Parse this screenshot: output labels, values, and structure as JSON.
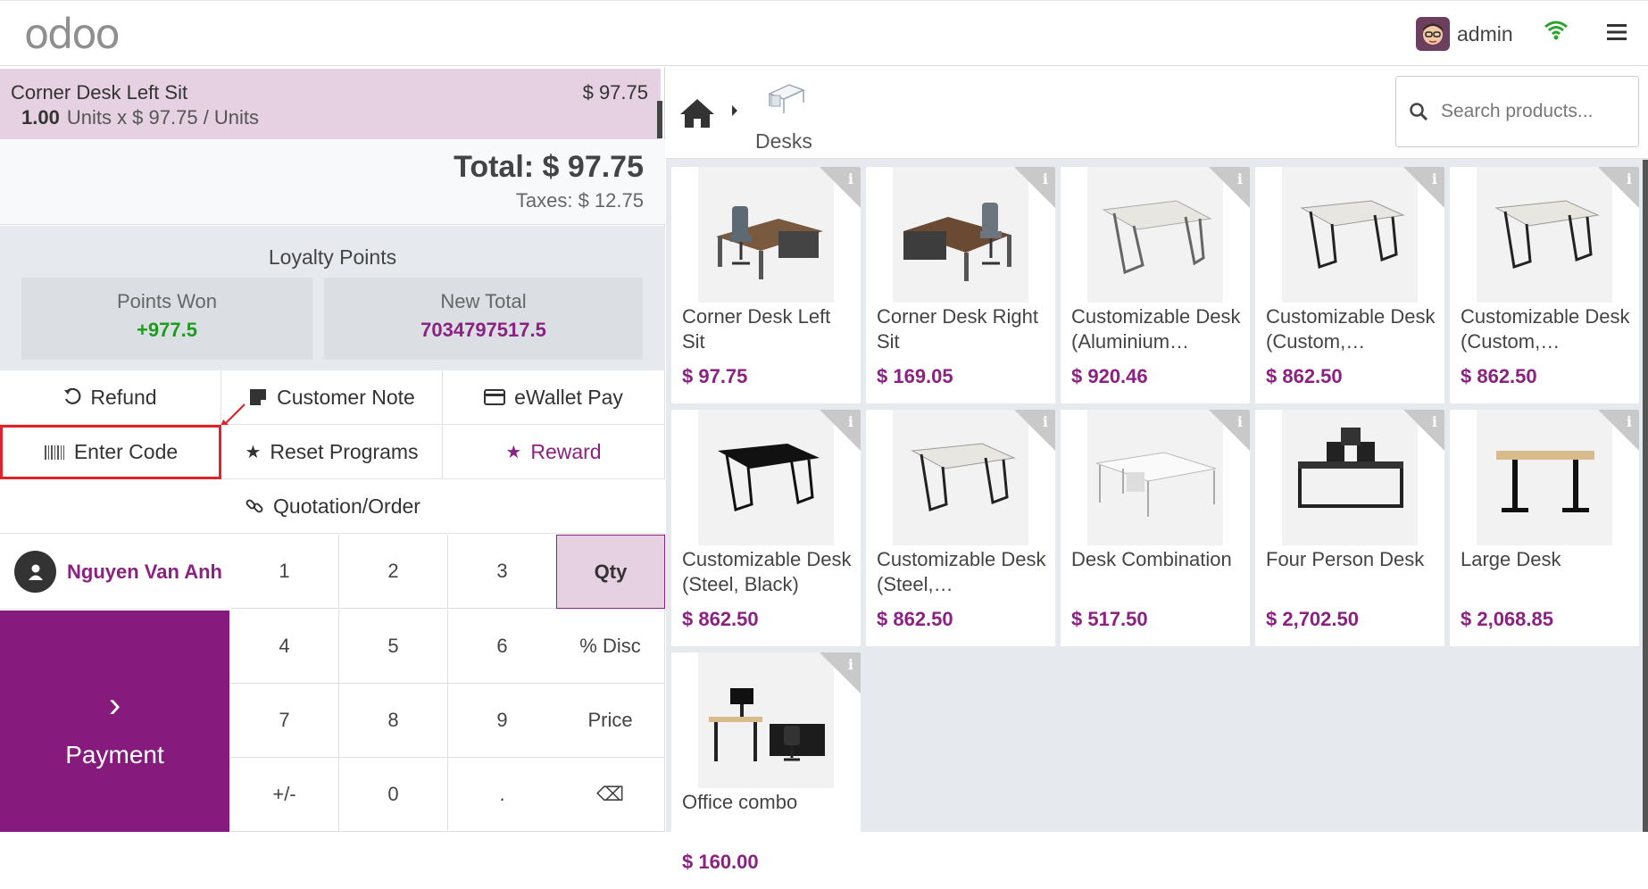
{
  "header": {
    "logo": "odoo",
    "username": "admin",
    "icons": {
      "wifi": "wifi-icon",
      "menu": "hamburger-menu-icon"
    },
    "accent": "#714B67"
  },
  "order": {
    "line": {
      "name": "Corner Desk Left Sit",
      "price": "$ 97.75",
      "qty": "1.00",
      "detail": "Units x $ 97.75 / Units"
    },
    "total": "Total: $ 97.75",
    "taxes": "Taxes: $ 12.75"
  },
  "loyalty": {
    "title": "Loyalty Points",
    "won_label": "Points Won",
    "won_value": "+977.5",
    "total_label": "New Total",
    "total_value": "7034797517.5"
  },
  "controls": {
    "refund": "Refund",
    "customer_note": "Customer Note",
    "ewallet": "eWallet Pay",
    "enter_code": "Enter Code",
    "reset_programs": "Reset Programs",
    "reward": "Reward",
    "quotation": "Quotation/Order"
  },
  "customer": {
    "name": "Nguyen Van Anh"
  },
  "payment": {
    "label": "Payment",
    "chevron": "›"
  },
  "numpad": {
    "k1": "1",
    "k2": "2",
    "k3": "3",
    "qty": "Qty",
    "k4": "4",
    "k5": "5",
    "k6": "6",
    "disc": "% Disc",
    "k7": "7",
    "k8": "8",
    "k9": "9",
    "price": "Price",
    "sign": "+/-",
    "k0": "0",
    "dot": ".",
    "back": "⌫"
  },
  "category": {
    "label": "Desks"
  },
  "search": {
    "placeholder": "Search products..."
  },
  "products": [
    {
      "name": "Corner Desk Left Sit",
      "price": "$ 97.75"
    },
    {
      "name": "Corner Desk Right Sit",
      "price": "$ 169.05"
    },
    {
      "name": "Customizable Desk (Aluminium…",
      "price": "$ 920.46"
    },
    {
      "name": "Customizable Desk (Custom,…",
      "price": "$ 862.50"
    },
    {
      "name": "Customizable Desk (Custom,…",
      "price": "$ 862.50"
    },
    {
      "name": "Customizable Desk (Steel, Black)",
      "price": "$ 862.50"
    },
    {
      "name": "Customizable Desk (Steel,…",
      "price": "$ 862.50"
    },
    {
      "name": "Desk Combination",
      "price": "$ 517.50"
    },
    {
      "name": "Four Person Desk",
      "price": "$ 2,702.50"
    },
    {
      "name": "Large Desk",
      "price": "$ 2,068.85"
    },
    {
      "name": "Office combo",
      "price": "$ 160.00"
    }
  ],
  "info_badge": "i"
}
